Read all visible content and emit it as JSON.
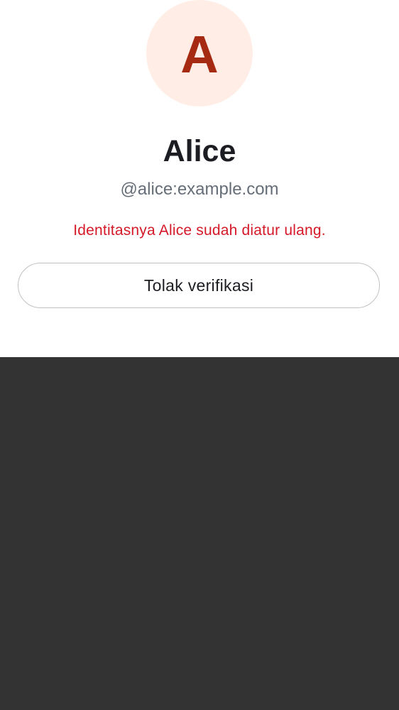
{
  "profile": {
    "avatar_initial": "A",
    "display_name": "Alice",
    "user_id": "@alice:example.com",
    "reset_notice": "Identitasnya Alice sudah diatur ulang."
  },
  "actions": {
    "decline_label": "Tolak verifikasi"
  },
  "colors": {
    "avatar_background": "#ffede6",
    "avatar_letter": "#a62a12",
    "warning_text": "#d51928",
    "backdrop": "#333333"
  }
}
